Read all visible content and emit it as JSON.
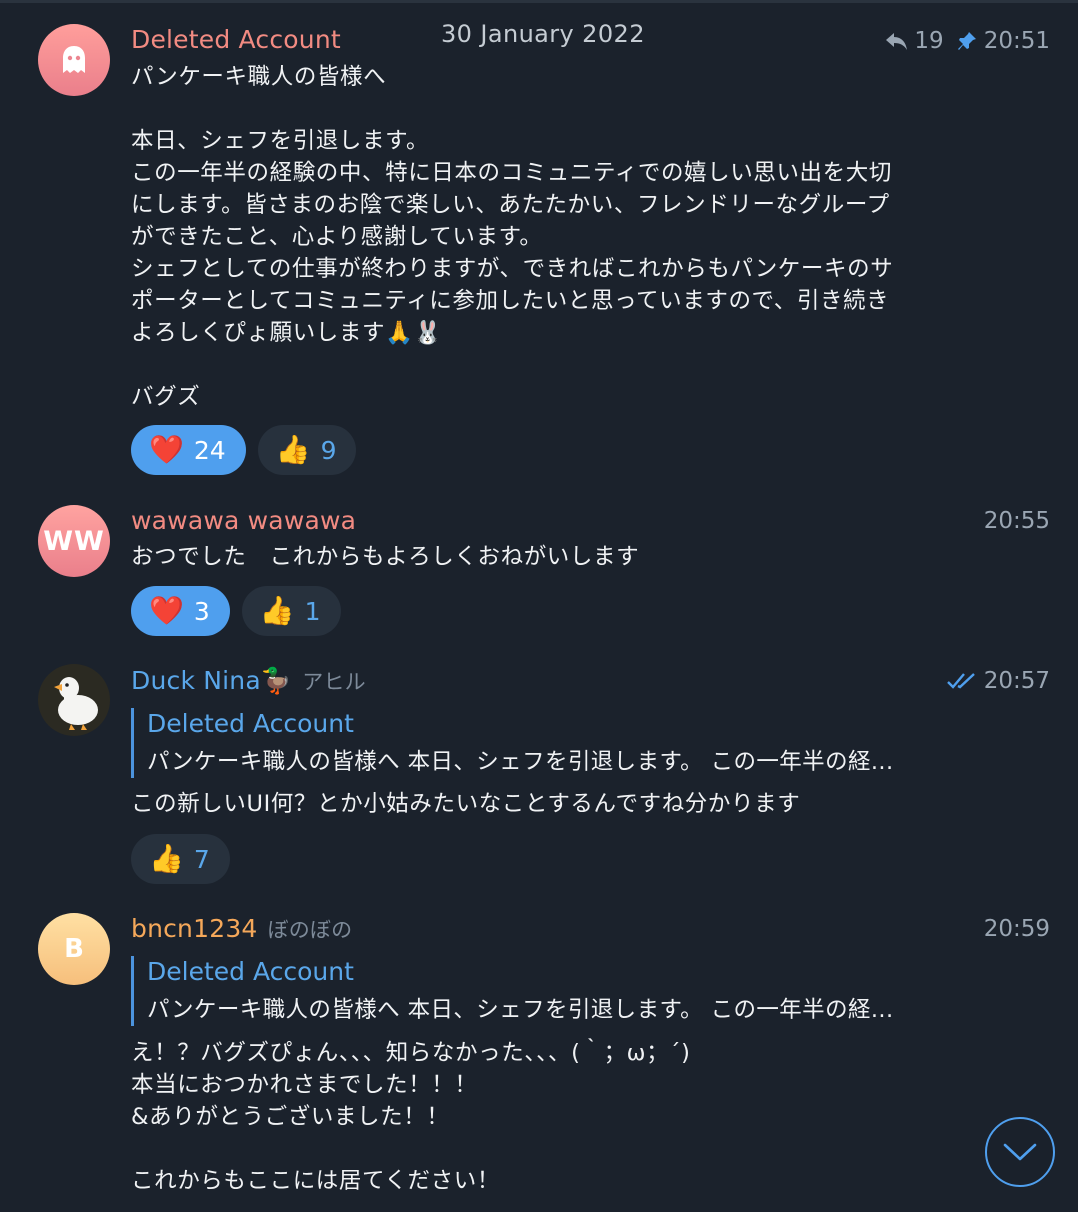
{
  "date_header": "30 January 2022",
  "messages": [
    {
      "sender": "Deleted Account",
      "time": "20:51",
      "reply_count": "19",
      "text": "パンケーキ職人の皆様へ\n\n本日、シェフを引退します。\nこの一年半の経験の中、特に日本のコミュニティでの嬉しい思い出を大切\nにします。皆さまのお陰で楽しい、あたたかい、フレンドリーなグループ\nができたこと、心より感謝しています。\nシェフとしての仕事が終わりますが、できればこれからもパンケーキのサ\nポーターとしてコミュニティに参加したいと思っていますので、引き続き\nよろしくぴょ願いします🙏🐰\n\nバグズ",
      "reactions": [
        {
          "emoji": "❤️",
          "count": "24"
        },
        {
          "emoji": "👍",
          "count": "9"
        }
      ]
    },
    {
      "sender": "wawawa wawawa",
      "avatar_initials": "WW",
      "time": "20:55",
      "text": "おつでした　これからもよろしくおねがいします",
      "reactions": [
        {
          "emoji": "❤️",
          "count": "3"
        },
        {
          "emoji": "👍",
          "count": "1"
        }
      ]
    },
    {
      "sender": "Duck Nina🦆",
      "badge": "アヒル",
      "time": "20:57",
      "reply_name": "Deleted Account",
      "reply_text": "パンケーキ職人の皆様へ  本日、シェフを引退します。 この一年半の経...",
      "text": "この新しいUI何？とか小姑みたいなことするんですね分かります",
      "reactions": [
        {
          "emoji": "👍",
          "count": "7"
        }
      ]
    },
    {
      "sender": "bncn1234",
      "badge": "ぼのぼの",
      "avatar_initials": "B",
      "time": "20:59",
      "reply_name": "Deleted Account",
      "reply_text": "パンケーキ職人の皆様へ  本日、シェフを引退します。 この一年半の経...",
      "text": "え！？バグズぴょん、、、知らなかった、、、(｀；ω；´)\n本当におつかれさまでした！！！\n&ありがとうございました！！\n\nこれからもここには居てください！"
    }
  ]
}
